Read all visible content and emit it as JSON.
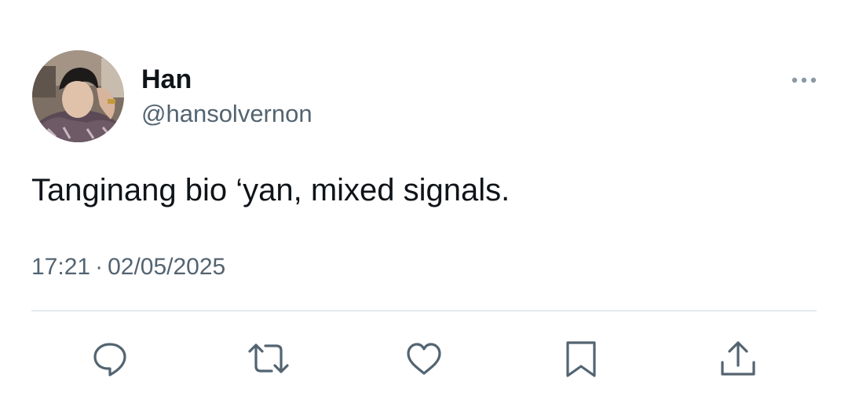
{
  "tweet": {
    "author": {
      "display_name": "Han",
      "handle": "@hansolvernon"
    },
    "text": "Tanginang bio ‘yan, mixed signals.",
    "time": "17:21",
    "separator": "·",
    "date": "02/05/2025"
  },
  "icons": {
    "more": "more-horizontal-icon",
    "reply": "reply-icon",
    "retweet": "retweet-icon",
    "like": "heart-icon",
    "bookmark": "bookmark-icon",
    "share": "share-icon"
  },
  "colors": {
    "text_primary": "#0f1419",
    "text_secondary": "#536471",
    "divider": "#cfd9de",
    "icon": "#536471"
  }
}
